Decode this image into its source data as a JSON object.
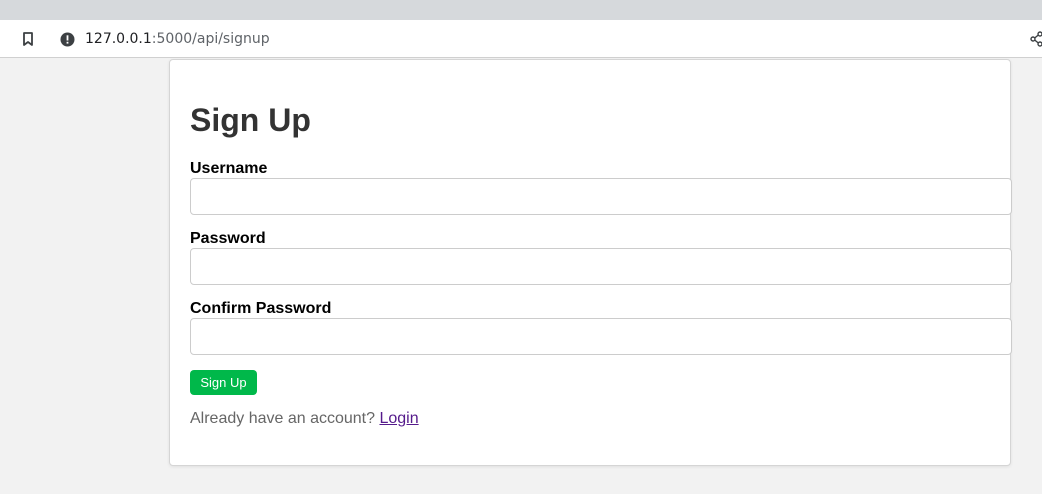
{
  "browser": {
    "url_host": "127.0.0.1",
    "url_rest": ":5000/api/signup",
    "icons": {
      "bookmark": "bookmark-icon",
      "site_info": "info-icon",
      "share": "share-icon"
    }
  },
  "form": {
    "title": "Sign Up",
    "fields": [
      {
        "label": "Username",
        "value": "",
        "placeholder": ""
      },
      {
        "label": "Password",
        "value": "",
        "placeholder": ""
      },
      {
        "label": "Confirm Password",
        "value": "",
        "placeholder": ""
      }
    ],
    "submit_label": "Sign Up",
    "footer_prompt": "Already have an account? ",
    "footer_link": "Login"
  },
  "colors": {
    "page_background": "#f2f2f2",
    "button_green": "#00b84a",
    "link_visited": "#551a8b"
  }
}
